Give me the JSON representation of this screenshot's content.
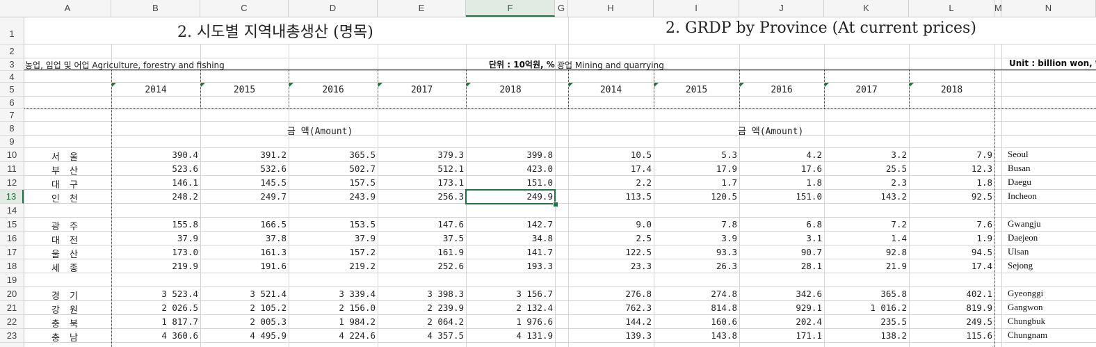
{
  "columns": [
    "A",
    "B",
    "C",
    "D",
    "E",
    "F",
    "G",
    "H",
    "I",
    "J",
    "K",
    "L",
    "M",
    "N"
  ],
  "active_column": "F",
  "active_row": "13",
  "row_numbers": [
    "1",
    "2",
    "3",
    "4",
    "5",
    "6",
    "7",
    "8",
    "9",
    "10",
    "11",
    "12",
    "13",
    "14",
    "15",
    "16",
    "17",
    "18",
    "19",
    "20",
    "21",
    "22",
    "23"
  ],
  "title_kr": "2. 시도별 지역내총생산 (명목)",
  "title_en": "2. GRDP by Province (At current prices)",
  "left_section": "농업, 임업 및 어업  Agriculture, forestry and fishing",
  "left_unit": "단위 : 10억원, %",
  "right_section": "광업  Mining and quarrying",
  "right_unit": "Unit : billion won, %",
  "years_left": [
    "2014",
    "2015",
    "2016",
    "2017",
    "2018"
  ],
  "years_right": [
    "2014",
    "2015",
    "2016",
    "2017",
    "2018"
  ],
  "amount_label_left": "금      액(Amount)",
  "amount_label_right": "금      액(Amount)",
  "rows": [
    {
      "row": "10",
      "kr": "서울",
      "en": "Seoul",
      "left": [
        "390.4",
        "391.2",
        "365.5",
        "379.3",
        "399.8"
      ],
      "right": [
        "10.5",
        "5.3",
        "4.2",
        "3.2",
        "7.9"
      ]
    },
    {
      "row": "11",
      "kr": "부산",
      "en": "Busan",
      "left": [
        "523.6",
        "532.6",
        "502.7",
        "512.1",
        "423.0"
      ],
      "right": [
        "17.4",
        "17.9",
        "17.6",
        "25.5",
        "12.3"
      ]
    },
    {
      "row": "12",
      "kr": "대구",
      "en": "Daegu",
      "left": [
        "146.1",
        "145.5",
        "157.5",
        "173.1",
        "151.0"
      ],
      "right": [
        "2.2",
        "1.7",
        "1.8",
        "2.3",
        "1.8"
      ]
    },
    {
      "row": "13",
      "kr": "인천",
      "en": "Incheon",
      "left": [
        "248.2",
        "249.7",
        "243.9",
        "256.3",
        "249.9"
      ],
      "right": [
        "113.5",
        "120.5",
        "151.0",
        "143.2",
        "92.5"
      ]
    },
    {
      "row": "15",
      "kr": "광주",
      "en": "Gwangju",
      "left": [
        "155.8",
        "166.5",
        "153.5",
        "147.6",
        "142.7"
      ],
      "right": [
        "9.0",
        "7.8",
        "6.8",
        "7.2",
        "7.6"
      ]
    },
    {
      "row": "16",
      "kr": "대전",
      "en": "Daejeon",
      "left": [
        "37.9",
        "37.8",
        "37.9",
        "37.5",
        "34.8"
      ],
      "right": [
        "2.5",
        "3.9",
        "3.1",
        "1.4",
        "1.9"
      ]
    },
    {
      "row": "17",
      "kr": "울산",
      "en": "Ulsan",
      "left": [
        "173.0",
        "161.3",
        "157.2",
        "161.9",
        "141.7"
      ],
      "right": [
        "122.5",
        "93.3",
        "90.7",
        "92.8",
        "94.5"
      ]
    },
    {
      "row": "18",
      "kr": "세종",
      "en": "Sejong",
      "left": [
        "219.9",
        "191.6",
        "219.2",
        "252.6",
        "193.3"
      ],
      "right": [
        "23.3",
        "26.3",
        "28.1",
        "21.9",
        "17.4"
      ]
    },
    {
      "row": "20",
      "kr": "경기",
      "en": "Gyeonggi",
      "left": [
        "3 523.4",
        "3 521.4",
        "3 339.4",
        "3 398.3",
        "3 156.7"
      ],
      "right": [
        "276.8",
        "274.8",
        "342.6",
        "365.8",
        "402.1"
      ]
    },
    {
      "row": "21",
      "kr": "강원",
      "en": "Gangwon",
      "left": [
        "2 026.5",
        "2 105.2",
        "2 156.0",
        "2 239.9",
        "2 132.4"
      ],
      "right": [
        "762.3",
        "814.8",
        "929.1",
        "1 016.2",
        "819.9"
      ]
    },
    {
      "row": "22",
      "kr": "충북",
      "en": "Chungbuk",
      "left": [
        "1 817.7",
        "2 005.3",
        "1 984.2",
        "2 064.2",
        "1 976.6"
      ],
      "right": [
        "144.2",
        "160.6",
        "202.4",
        "235.5",
        "249.5"
      ]
    },
    {
      "row": "23",
      "kr": "충남",
      "en": "Chungnam",
      "left": [
        "4 360.6",
        "4 495.9",
        "4 224.6",
        "4 357.5",
        "4 131.9"
      ],
      "right": [
        "139.3",
        "143.8",
        "171.1",
        "138.2",
        "115.6"
      ]
    }
  ]
}
